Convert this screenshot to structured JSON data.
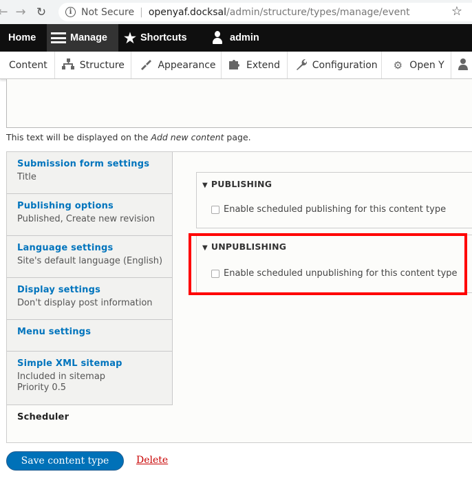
{
  "browser": {
    "security": "Not Secure",
    "url_host": "openyaf.docksal",
    "url_path": "/admin/structure/types/manage/event"
  },
  "toolbar": {
    "home": "Home",
    "manage": "Manage",
    "shortcuts": "Shortcuts",
    "admin": "admin"
  },
  "tray": {
    "content": "Content",
    "structure": "Structure",
    "appearance": "Appearance",
    "extend": "Extend",
    "configuration": "Configuration",
    "openy": "Open Y"
  },
  "help": {
    "prefix": "This text will be displayed on the ",
    "emphasis": "Add new content",
    "suffix": " page."
  },
  "vtabs": [
    {
      "title": "Submission form settings",
      "summary": [
        "Title"
      ]
    },
    {
      "title": "Publishing options",
      "summary": [
        "Published, Create new revision"
      ]
    },
    {
      "title": "Language settings",
      "summary": [
        "Site's default language (English)"
      ]
    },
    {
      "title": "Display settings",
      "summary": [
        "Don't display post information"
      ]
    },
    {
      "title": "Menu settings",
      "summary": []
    },
    {
      "title": "Simple XML sitemap",
      "summary": [
        "Included in sitemap",
        "Priority 0.5"
      ]
    },
    {
      "title": "Scheduler",
      "summary": [],
      "active": true
    }
  ],
  "scheduler": {
    "publishing": {
      "title": "PUBLISHING",
      "checkbox_label": "Enable scheduled publishing for this content type",
      "checked": false
    },
    "unpublishing": {
      "title": "UNPUBLISHING",
      "checkbox_label": "Enable scheduled unpublishing for this content type",
      "checked": false
    }
  },
  "actions": {
    "save": "Save content type",
    "delete": "Delete"
  },
  "colors": {
    "link": "#0074bd",
    "primary_button": "#0071b8",
    "delete": "#c80000",
    "highlight": "#ff0000"
  }
}
